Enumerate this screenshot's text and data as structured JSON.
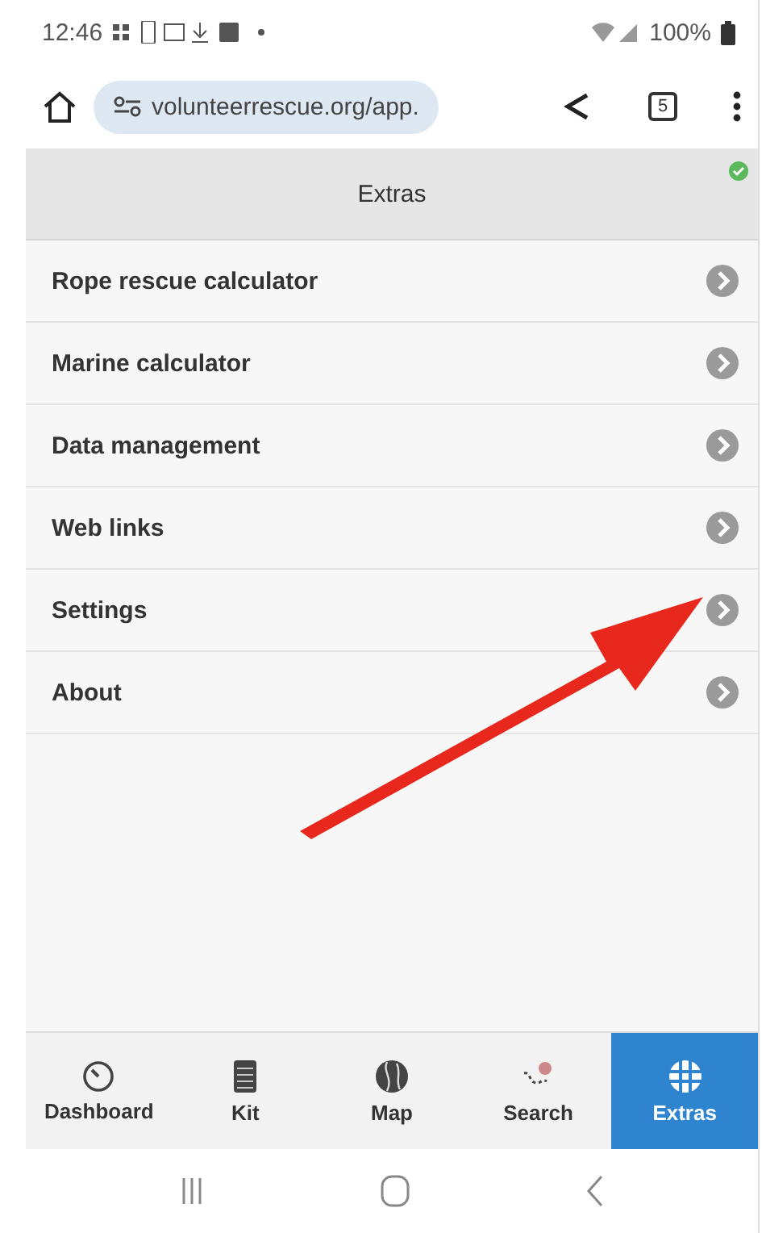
{
  "status_bar": {
    "time": "12:46",
    "battery": "100%"
  },
  "browser": {
    "url": "volunteerrescue.org/app.",
    "tab_count": "5"
  },
  "header": {
    "title": "Extras"
  },
  "menu_items": [
    {
      "label": "Rope rescue calculator"
    },
    {
      "label": "Marine calculator"
    },
    {
      "label": "Data management"
    },
    {
      "label": "Web links"
    },
    {
      "label": "Settings"
    },
    {
      "label": "About"
    }
  ],
  "tabs": [
    {
      "label": "Dashboard",
      "kind": "gauge",
      "selected": false
    },
    {
      "label": "Kit",
      "kind": "notepad",
      "selected": false
    },
    {
      "label": "Map",
      "kind": "globe",
      "selected": false
    },
    {
      "label": "Search",
      "kind": "trail",
      "selected": false
    },
    {
      "label": "Extras",
      "kind": "grid",
      "selected": true
    }
  ]
}
